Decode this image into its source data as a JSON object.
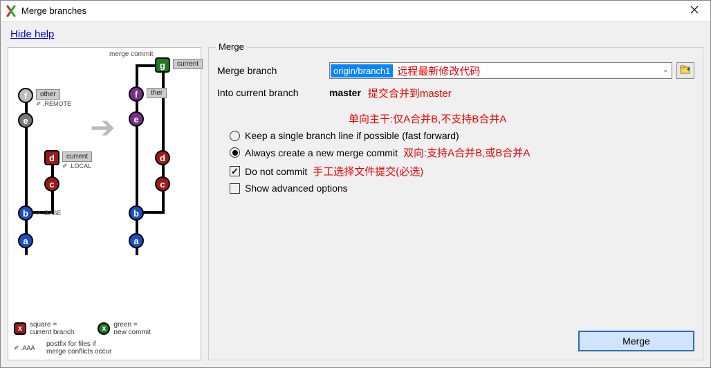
{
  "window": {
    "title": "Merge branches",
    "close_tooltip": "Close"
  },
  "header": {
    "hide_help": "Hide help"
  },
  "merge": {
    "group_title": "Merge",
    "merge_branch_label": "Merge branch",
    "merge_branch_value": "origin/branch1",
    "merge_branch_annotation": "远程最新修改代码",
    "into_label": "Into current branch",
    "into_value": "master",
    "into_annotation": "提交合并到master",
    "mode_annotation": "单向主干:仅A合并B,不支持B合并A",
    "radio_fast_forward": "Keep a single branch line if possible (fast forward)",
    "radio_always_new": "Always create a new merge commit",
    "radio_always_new_annotation": "双向:支持A合并B,或B合并A",
    "check_do_not_commit": "Do not commit",
    "check_do_not_commit_annotation": "手工选择文件提交(必选)",
    "check_show_advanced": "Show advanced options",
    "merge_button": "Merge"
  },
  "help": {
    "merge_commit_label": "merge commit",
    "current_tag": "current",
    "other_tag": "other",
    "remote_tag": "✐ .REMOTE",
    "local_tag": "✐ .LOCAL",
    "base_tag": "✐ .BASE",
    "legend_square": "square =\ncurrent branch",
    "legend_green": "green =\nnew commit",
    "legend_aaa": "✐ .AAA",
    "legend_conflict": "postfix for files if\nmerge conflicts occur"
  }
}
